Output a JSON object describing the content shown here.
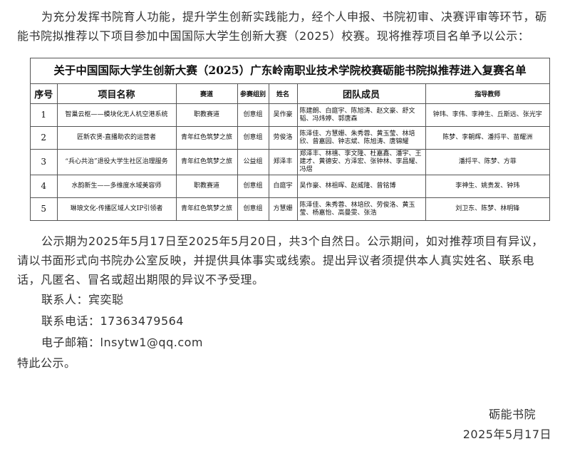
{
  "intro_text": "为充分发挥书院育人功能，提升学生创新实践能力，经个人申报、书院初审、决赛评审等环节，砺能书院拟推荐以下项目参加中国国际大学生创新大赛（2025）校赛。现将推荐项目名单予以公示：",
  "table": {
    "title": "关于中国国际大学生创新大赛（2025）广东岭南职业技术学院校赛砺能书院拟推荐进入复赛名单",
    "headers": {
      "no": "序号",
      "project": "项目名称",
      "track": "赛道",
      "group": "参赛组别",
      "leader": "姓名",
      "members": "团队成员",
      "advisors": "指导教师"
    },
    "rows": [
      {
        "no": "1",
        "project": "智巢云枢——模块化无人机空港系统",
        "track": "职教赛道",
        "group": "创意组",
        "leader": "吴作豪",
        "members": "陈建朗、白庭宇、陈旭涛、赵文豪、舒文韬、冯炜婷、郭唐森",
        "advisors": "钟玮、李伟、李神生、丘斯远、张光宇"
      },
      {
        "no": "2",
        "project": "匠新农贤-直播助农的运营者",
        "track": "青年红色筑梦之旅",
        "group": "创意组",
        "leader": "劳俊洛",
        "members": "陈泽佳、方慧姗、朱秀蓉、黄玉莹、林培欣、曾嘉园、钟志斌、陈旭涛、唐锦耀",
        "advisors": "陈梦、李朝辉、潘捋平、苗耀洲"
      },
      {
        "no": "3",
        "project": "“兵心共治”退役大学生社区治理服务",
        "track": "青年红色筑梦之旅",
        "group": "公益组",
        "leader": "郑泽丰",
        "members": "郑泽丰、林禧、李文隆、杜嘉鑫、潘宇、王建才、黄德安、方泽宏、张钟林、李昌耀、冯熠",
        "advisors": "潘捋平、陈梦、方菲"
      },
      {
        "no": "4",
        "project": "水韵新生——多维度水域美容师",
        "track": "职教赛道",
        "group": "创意组",
        "leader": "白庭宇",
        "members": "吴作豪、林祖晖、赵威隆、曾铭博",
        "advisors": "李神生、姚贵发、钟玮"
      },
      {
        "no": "5",
        "project": "琳琅文化-传播区域人文IP引领者",
        "track": "青年红色筑梦之旅",
        "group": "创意组",
        "leader": "方慧姗",
        "members": "陈泽佳、朱秀蓉、林培欣、劳俊洛、黄玉莹、杨嘉怡、高曼雯、张浩",
        "advisors": "刘卫东、陈梦、林明锋"
      }
    ]
  },
  "closing_text": "公示期为2025年5月17日至2025年5月20日，共3个自然日。公示期间，如对推荐项目有异议，请以书面形式向书院办公室反映，并提供具体事实或线索。提出异议者须提供本人真实姓名、联系电话，凡匿名、冒名或超出期限的异议不予受理。",
  "contact": {
    "person": "联系人：宾奕聪",
    "phone": "联系电话：17363479564",
    "email": "电子邮箱：lnsytw1@qq.com"
  },
  "final_text": "特此公示。",
  "signature": {
    "org": "砺能书院",
    "date": "2025年5月17日"
  }
}
